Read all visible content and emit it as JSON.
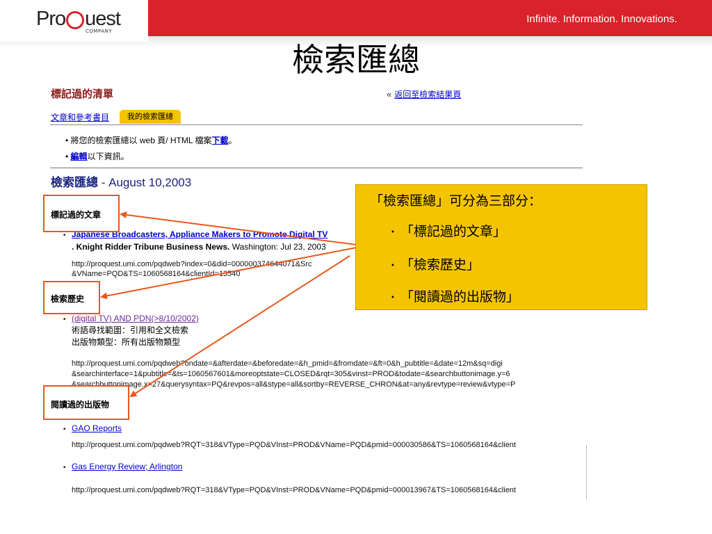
{
  "header": {
    "logo_text_left": "Pro",
    "logo_text_right": "uest",
    "logo_company": "COMPANY",
    "tagline": "Infinite. Information. Innovations."
  },
  "slide_title": "檢索匯總",
  "page": {
    "marked_list_title": "標記過的清單",
    "back_arrow": "«",
    "back_link": "返回至檢索結果頁",
    "tabs": [
      {
        "label": "文章和參考書目"
      },
      {
        "label": "我的檢索匯總"
      }
    ],
    "instructions": [
      {
        "bullet": "•",
        "prefix": "將您的檢索匯總以 web 頁/ HTML 檔案",
        "link": "下載",
        "suffix": "。"
      },
      {
        "bullet": "•",
        "prefix": "",
        "link": "編輯",
        "suffix": "以下資訊。"
      }
    ],
    "summary_heading_bold": "檢索匯總",
    "summary_heading_date": " - August 10,2003"
  },
  "sections": {
    "marked_articles": "標記過的文章",
    "search_history": "檢索歷史",
    "read_publications": "閱讀過的出版物"
  },
  "article": {
    "bullet": "•",
    "title": "Japanese Broadcasters, Appliance Makers to Promote Digital TV",
    "source_bold": ". Knight Ridder Tribune Business News.",
    "source_rest": " Washington: Jul 23, 2003",
    "url_line1": "http://proquest.umi.com/pqdweb?index=0&did=000000374644071&Src",
    "url_line2": "&VName=PQD&TS=1060568164&clientId=13540"
  },
  "history": {
    "bullet": "•",
    "query": "(digital TV) AND PDN(>8/10/2002)",
    "range": "術語尋找範圍：引用和全文檢索",
    "type": "出版物類型：所有出版物類型",
    "url_line1": "http://proquest.umi.com/pqdweb?ondate=&afterdate=&beforedate=&h_pmid=&fromdate=&ft=0&h_pubtitle=&date=12m&sq=digi",
    "url_line2": "&searchinterface=1&pubtitle=&ts=1060567601&moreoptstate=CLOSED&rqt=305&vinst=PROD&todate=&searchbuttonimage.y=6",
    "url_line3": "&searchbuttonimage.x=27&querysyntax=PQ&revpos=all&stype=all&sortby=REVERSE_CHRON&at=any&revtype=review&vtype=P"
  },
  "publications": [
    {
      "bullet": "•",
      "name": "GAO Reports",
      "url": "http://proquest.umi.com/pqdweb?RQT=318&VType=PQD&VInst=PROD&VName=PQD&pmid=000030586&TS=1060568164&client"
    },
    {
      "bullet": "•",
      "name": "Gas Energy Review; Arlington",
      "url": "http://proquest.umi.com/pqdweb?RQT=318&VType=PQD&VInst=PROD&VName=PQD&pmid=000013967&TS=1060568164&client"
    }
  ],
  "callout": {
    "title": "「檢索匯總」可分為三部分：",
    "bullet": "•",
    "items": [
      "「標記過的文章」",
      "「檢索歷史」",
      "「閱讀過的出版物」"
    ]
  },
  "colors": {
    "brand_red": "#d9222a",
    "callout_yellow": "#f5c400",
    "arrow_orange": "#e8571a",
    "link_blue": "#0000cc"
  }
}
